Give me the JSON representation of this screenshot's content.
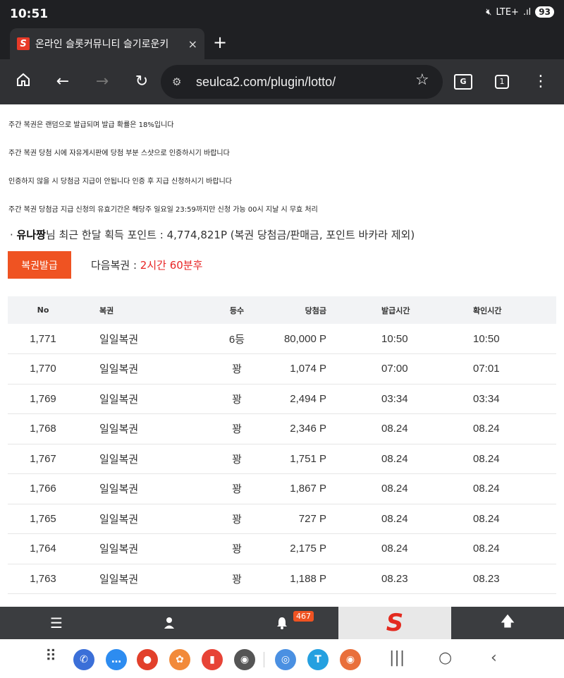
{
  "status": {
    "time": "10:51",
    "network": "LTE+",
    "signal": ".ıl",
    "battery": "93"
  },
  "tab": {
    "title": "온라인 슬롯커뮤니티 슬기로운키",
    "close": "×",
    "new_tab": "+"
  },
  "toolbar": {
    "url": "seulca2.com/plugin/lotto/",
    "tab_count": "1"
  },
  "notices": [
    "주간 복권은 랜덤으로 발급되며 발급 확률은 18%입니다",
    "주간 복권 당첨 시에 자유게시판에 당첨 부분 스샷으로 인증하시기 바랍니다",
    "인증하지 않을 시 당첨금 지급이 안됩니다 인증 후 지급 신청하시기 바랍니다",
    "주간 복권 당첨금 지급 신청의 유효기간은 해당주 일요일 23:59까지만 신청 가능 00시 지날 시 무효 처리"
  ],
  "points": {
    "prefix": "· ",
    "user": "유나짱",
    "text": "님 최근 한달 획득 포인트 : 4,774,821P (복권 당첨금/판매금, 포인트 바카라 제외)"
  },
  "issue_button": "복권발급",
  "next": {
    "label": "다음복권 : ",
    "time": "2시간 60분후"
  },
  "table": {
    "headers": [
      "No",
      "복권",
      "등수",
      "당첨금",
      "발급시간",
      "확인시간"
    ],
    "rows": [
      [
        "1,771",
        "일일복권",
        "6등",
        "80,000 P",
        "10:50",
        "10:50"
      ],
      [
        "1,770",
        "일일복권",
        "꽝",
        "1,074 P",
        "07:00",
        "07:01"
      ],
      [
        "1,769",
        "일일복권",
        "꽝",
        "2,494 P",
        "03:34",
        "03:34"
      ],
      [
        "1,768",
        "일일복권",
        "꽝",
        "2,346 P",
        "08.24",
        "08.24"
      ],
      [
        "1,767",
        "일일복권",
        "꽝",
        "1,751 P",
        "08.24",
        "08.24"
      ],
      [
        "1,766",
        "일일복권",
        "꽝",
        "1,867 P",
        "08.24",
        "08.24"
      ],
      [
        "1,765",
        "일일복권",
        "꽝",
        "727 P",
        "08.24",
        "08.24"
      ],
      [
        "1,764",
        "일일복권",
        "꽝",
        "2,175 P",
        "08.24",
        "08.24"
      ],
      [
        "1,763",
        "일일복권",
        "꽝",
        "1,188 P",
        "08.23",
        "08.23"
      ]
    ]
  },
  "bottom_nav": {
    "notification_count": "467",
    "logo": "S"
  },
  "icons": {
    "home": "home-icon",
    "back": "back-arrow-icon",
    "forward": "forward-arrow-icon",
    "reload": "reload-icon",
    "site_settings": "tune-icon",
    "bookmark": "star-icon",
    "translate": "translate-icon",
    "menu": "more-vert-icon"
  },
  "colors": {
    "accent": "#ef5322",
    "next_time": "#e82424",
    "toolbar": "#303134"
  }
}
